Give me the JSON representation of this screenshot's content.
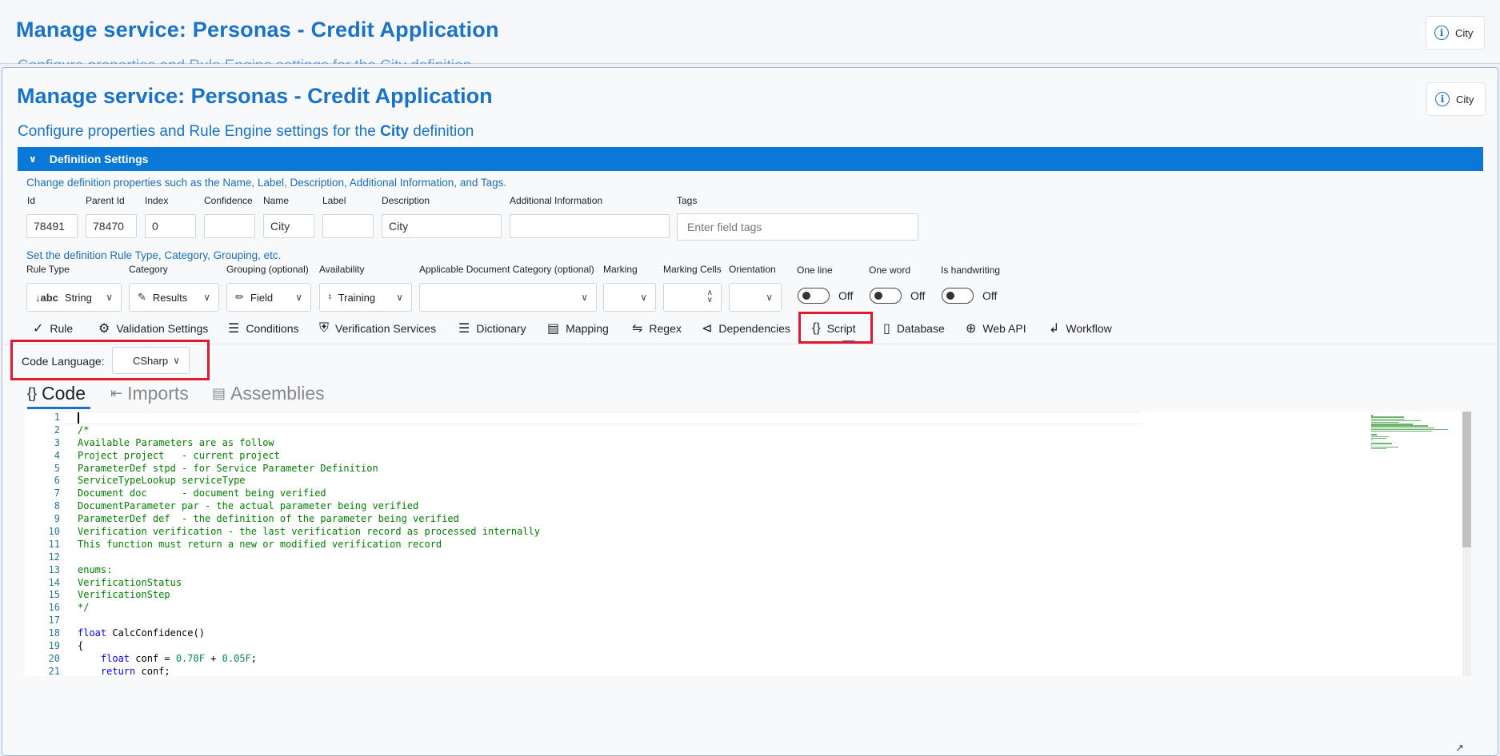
{
  "back_panel": {
    "title": "Manage service: Personas - Credit Application",
    "subtitle": "Configure properties and Rule Engine settings for the City definition",
    "badge": "City"
  },
  "header": {
    "title": "Manage service: Personas - Credit Application",
    "subtitle_prefix": "Configure properties and Rule Engine settings for the ",
    "subtitle_bold": "City",
    "subtitle_suffix": " definition",
    "badge": "City"
  },
  "definition_settings": {
    "section_title": "Definition Settings",
    "hint": "Change definition properties such as the Name, Label, Description, Additional Information, and Tags.",
    "fields": {
      "id": {
        "label": "Id",
        "value": "78491"
      },
      "parent_id": {
        "label": "Parent Id",
        "value": "78470"
      },
      "index": {
        "label": "Index",
        "value": "0"
      },
      "confidence": {
        "label": "Confidence",
        "value": ""
      },
      "name": {
        "label": "Name",
        "value": "City"
      },
      "label": {
        "label": "Label",
        "value": ""
      },
      "description": {
        "label": "Description",
        "value": "City"
      },
      "additional_info": {
        "label": "Additional Information",
        "value": ""
      },
      "tags": {
        "label": "Tags",
        "placeholder": "Enter field tags"
      }
    },
    "rule_hint": "Set the definition Rule Type, Category, Grouping, etc.",
    "dropdowns": {
      "rule_type": {
        "label": "Rule Type",
        "value": "String",
        "icon": "↓abc"
      },
      "category": {
        "label": "Category",
        "value": "Results"
      },
      "grouping": {
        "label": "Grouping (optional)",
        "value": "Field"
      },
      "availability": {
        "label": "Availability",
        "value": "Training"
      },
      "doc_category": {
        "label": "Applicable Document Category (optional)",
        "value": ""
      },
      "marking": {
        "label": "Marking",
        "value": ""
      },
      "marking_cells": {
        "label": "Marking Cells",
        "value": ""
      },
      "orientation": {
        "label": "Orientation",
        "value": ""
      }
    },
    "toggles": {
      "one_line": {
        "label": "One line",
        "state": "Off"
      },
      "one_word": {
        "label": "One word",
        "state": "Off"
      },
      "handwriting": {
        "label": "Is handwriting",
        "state": "Off"
      }
    }
  },
  "tabs": [
    {
      "label": "Rule"
    },
    {
      "label": "Validation Settings"
    },
    {
      "label": "Conditions"
    },
    {
      "label": "Verification Services"
    },
    {
      "label": "Dictionary"
    },
    {
      "label": "Mapping"
    },
    {
      "label": "Regex"
    },
    {
      "label": "Dependencies"
    },
    {
      "label": "Script"
    },
    {
      "label": "Database"
    },
    {
      "label": "Web API"
    },
    {
      "label": "Workflow"
    }
  ],
  "script": {
    "language_label": "Code Language:",
    "language_value": "CSharp",
    "code_tabs": [
      "Code",
      "Imports",
      "Assemblies"
    ],
    "line_numbers": [
      "1",
      "2",
      "3",
      "4",
      "5",
      "6",
      "7",
      "8",
      "9",
      "10",
      "11",
      "12",
      "13",
      "14",
      "15",
      "16",
      "17",
      "18",
      "19",
      "20",
      "21"
    ],
    "code_lines": [
      "",
      "/*",
      "Available Parameters are as follow",
      "Project project   - current project",
      "ParameterDef stpd - for Service Parameter Definition",
      "ServiceTypeLookup serviceType",
      "Document doc      - document being verified",
      "DocumentParameter par - the actual parameter being verified",
      "ParameterDef def  - the definition of the parameter being verified",
      "Verification verification - the last verification record as processed internally",
      "This function must return a new or modified verification record",
      "",
      "enums:",
      "VerificationStatus",
      "VerificationStep",
      "*/",
      "",
      "",
      "{",
      "",
      ""
    ],
    "line18": {
      "kw": "float",
      "rest": " CalcConfidence()"
    },
    "line20": {
      "indent": "    ",
      "kw": "float",
      "mid": " conf = ",
      "n1": "0.70F",
      "plus": " + ",
      "n2": "0.05F",
      "end": ";"
    },
    "line21": {
      "indent": "    ",
      "kw": "return",
      "rest": " conf;"
    }
  },
  "colors": {
    "accent": "#1a73c7",
    "header_bar": "#0a78d7",
    "highlight": "#e0192e",
    "comment": "#008000"
  }
}
